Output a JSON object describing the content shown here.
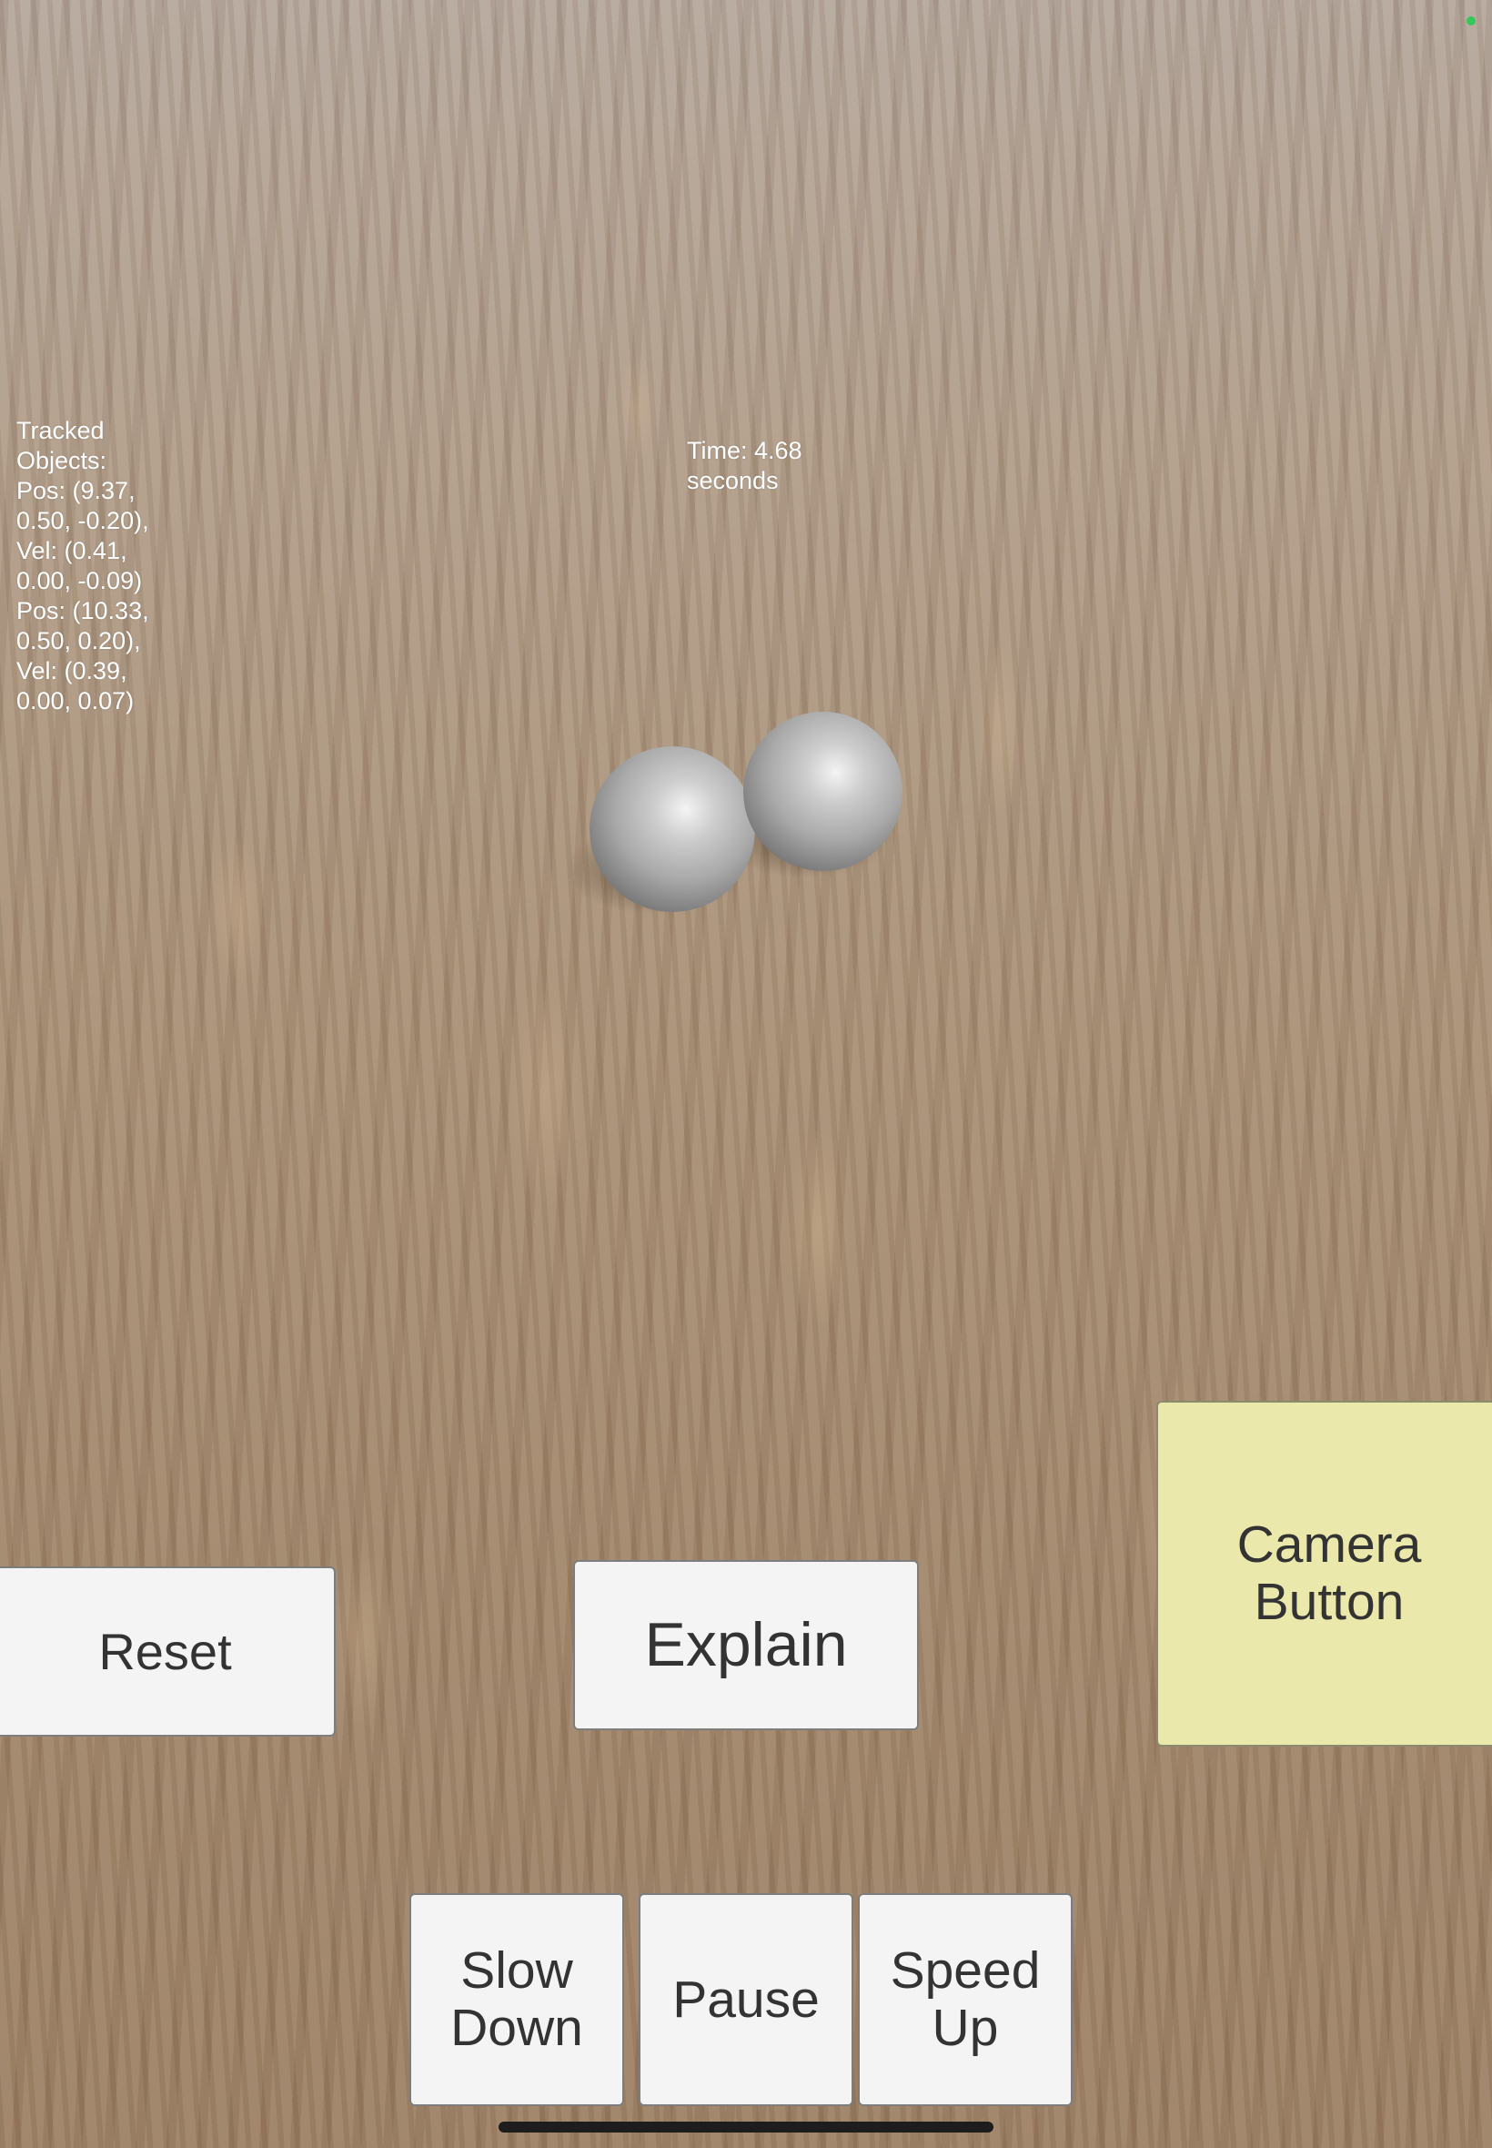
{
  "hud": {
    "tracked_lines": [
      "Tracked",
      "Objects:",
      "Pos: (9.37,",
      "0.50, -0.20),",
      "Vel: (0.41,",
      "0.00, -0.09)",
      "Pos: (10.33,",
      "0.50, 0.20),",
      "Vel: (0.39,",
      "0.00, 0.07)"
    ],
    "time_lines": [
      "Time: 4.68",
      "seconds"
    ]
  },
  "buttons": {
    "reset": "Reset",
    "explain": "Explain",
    "camera": [
      "Camera",
      "Button"
    ],
    "slow_down": [
      "Slow",
      "Down"
    ],
    "pause": "Pause",
    "speed_up": [
      "Speed",
      "Up"
    ]
  },
  "colors": {
    "camera_button": "#ebe8ab",
    "button": "#f4f4f4",
    "status_dot": "#34c759"
  }
}
